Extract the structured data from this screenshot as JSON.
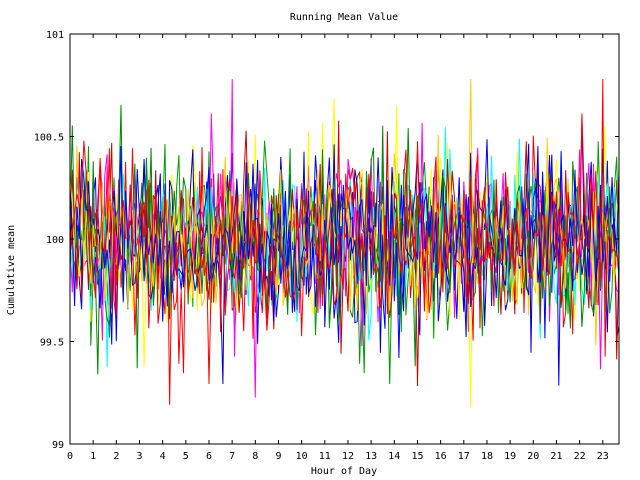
{
  "chart_data": {
    "type": "line",
    "title": "Running Mean Value",
    "xlabel": "Hour of Day",
    "ylabel": "Cumulative mean",
    "xlim": [
      0,
      23.7
    ],
    "ylim": [
      99,
      101
    ],
    "x_ticks": [
      0,
      1,
      2,
      3,
      4,
      5,
      6,
      7,
      8,
      9,
      10,
      11,
      12,
      13,
      14,
      15,
      16,
      17,
      18,
      19,
      20,
      21,
      22,
      23
    ],
    "x_tick_labels": [
      "0",
      "1",
      "2",
      "3",
      "4",
      "5",
      "6",
      "7",
      "8",
      "9",
      "10",
      "11",
      "12",
      "13",
      "14",
      "15",
      "16",
      "17",
      "18",
      "19",
      "20",
      "21",
      "22",
      "23"
    ],
    "y_ticks": [
      99,
      99.5,
      100,
      100.5,
      101
    ],
    "y_tick_labels": [
      "99",
      "99.5",
      "100",
      "100.5",
      "101"
    ],
    "grid": false,
    "legend": "none",
    "series_colors": [
      "#ff0000",
      "#0000ff",
      "#00a000",
      "#ff00ff",
      "#ffff00",
      "#00ffff",
      "#cc0000",
      "#0000cc",
      "#008800",
      "#ffcc00",
      "#0000ff",
      "#ff0000"
    ],
    "series_count": 12,
    "points_per_series": 238,
    "value_range_observed": [
      99.18,
      100.78
    ],
    "series_pattern": "noisy fluctuations centered near 100, amplitude roughly ±0.5"
  }
}
